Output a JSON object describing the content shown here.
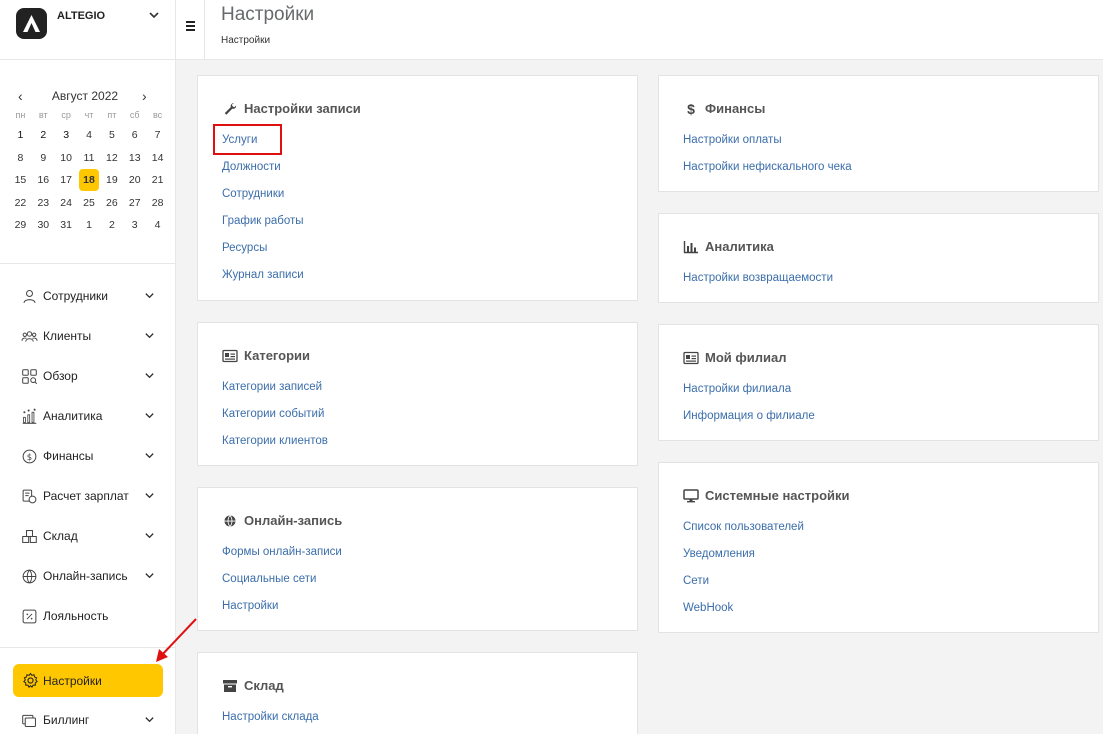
{
  "brand": {
    "name": "ALTEGIO"
  },
  "calendar": {
    "month": "Август 2022",
    "weekdays": [
      "пн",
      "вт",
      "ср",
      "чт",
      "пт",
      "сб",
      "вс"
    ],
    "weeks": [
      [
        "1",
        "2",
        "3",
        "4",
        "5",
        "6",
        "7"
      ],
      [
        "8",
        "9",
        "10",
        "11",
        "12",
        "13",
        "14"
      ],
      [
        "15",
        "16",
        "17",
        "18",
        "19",
        "20",
        "21"
      ],
      [
        "22",
        "23",
        "24",
        "25",
        "26",
        "27",
        "28"
      ],
      [
        "29",
        "30",
        "31",
        "1",
        "2",
        "3",
        "4"
      ]
    ],
    "today": "18"
  },
  "nav": {
    "items": [
      {
        "label": "Сотрудники",
        "icon": "user-icon",
        "expandable": true
      },
      {
        "label": "Клиенты",
        "icon": "users-icon",
        "expandable": true
      },
      {
        "label": "Обзор",
        "icon": "grid-search-icon",
        "expandable": true
      },
      {
        "label": "Аналитика",
        "icon": "analytics-icon",
        "expandable": true
      },
      {
        "label": "Финансы",
        "icon": "dollar-circle-icon",
        "expandable": true
      },
      {
        "label": "Расчет зарплат",
        "icon": "payroll-icon",
        "expandable": true
      },
      {
        "label": "Склад",
        "icon": "boxes-icon",
        "expandable": true
      },
      {
        "label": "Онлайн-запись",
        "icon": "globe-icon",
        "expandable": true
      },
      {
        "label": "Лояльность",
        "icon": "percent-icon",
        "expandable": false
      }
    ],
    "active": {
      "label": "Настройки",
      "icon": "gear-icon"
    },
    "billing": {
      "label": "Биллинг",
      "icon": "billing-icon"
    }
  },
  "header": {
    "title": "Настройки",
    "breadcrumb": "Настройки"
  },
  "cards": {
    "booking": {
      "title": "Настройки записи",
      "icon": "wrench-icon",
      "links": [
        "Услуги",
        "Должности",
        "Сотрудники",
        "График работы",
        "Ресурсы",
        "Журнал записи"
      ]
    },
    "categories": {
      "title": "Категории",
      "icon": "id-card-icon",
      "links": [
        "Категории записей",
        "Категории событий",
        "Категории клиентов"
      ]
    },
    "online": {
      "title": "Онлайн-запись",
      "icon": "globe-icon",
      "links": [
        "Формы онлайн-записи",
        "Социальные сети",
        "Настройки"
      ]
    },
    "warehouse": {
      "title": "Склад",
      "icon": "archive-icon",
      "links": [
        "Настройки склада"
      ]
    },
    "finance": {
      "title": "Финансы",
      "icon": "dollar-icon",
      "links": [
        "Настройки оплаты",
        "Настройки нефискального чека"
      ]
    },
    "analytics": {
      "title": "Аналитика",
      "icon": "bar-chart-icon",
      "links": [
        "Настройки возвращаемости"
      ]
    },
    "branch": {
      "title": "Мой филиал",
      "icon": "id-card-icon",
      "links": [
        "Настройки филиала",
        "Информация о филиале"
      ]
    },
    "system": {
      "title": "Системные настройки",
      "icon": "monitor-icon",
      "links": [
        "Список пользователей",
        "Уведомления",
        "Сети",
        "WebHook"
      ]
    }
  },
  "colors": {
    "accent": "#ffc700",
    "link": "#3b6eaa",
    "highlight": "#e01010"
  }
}
